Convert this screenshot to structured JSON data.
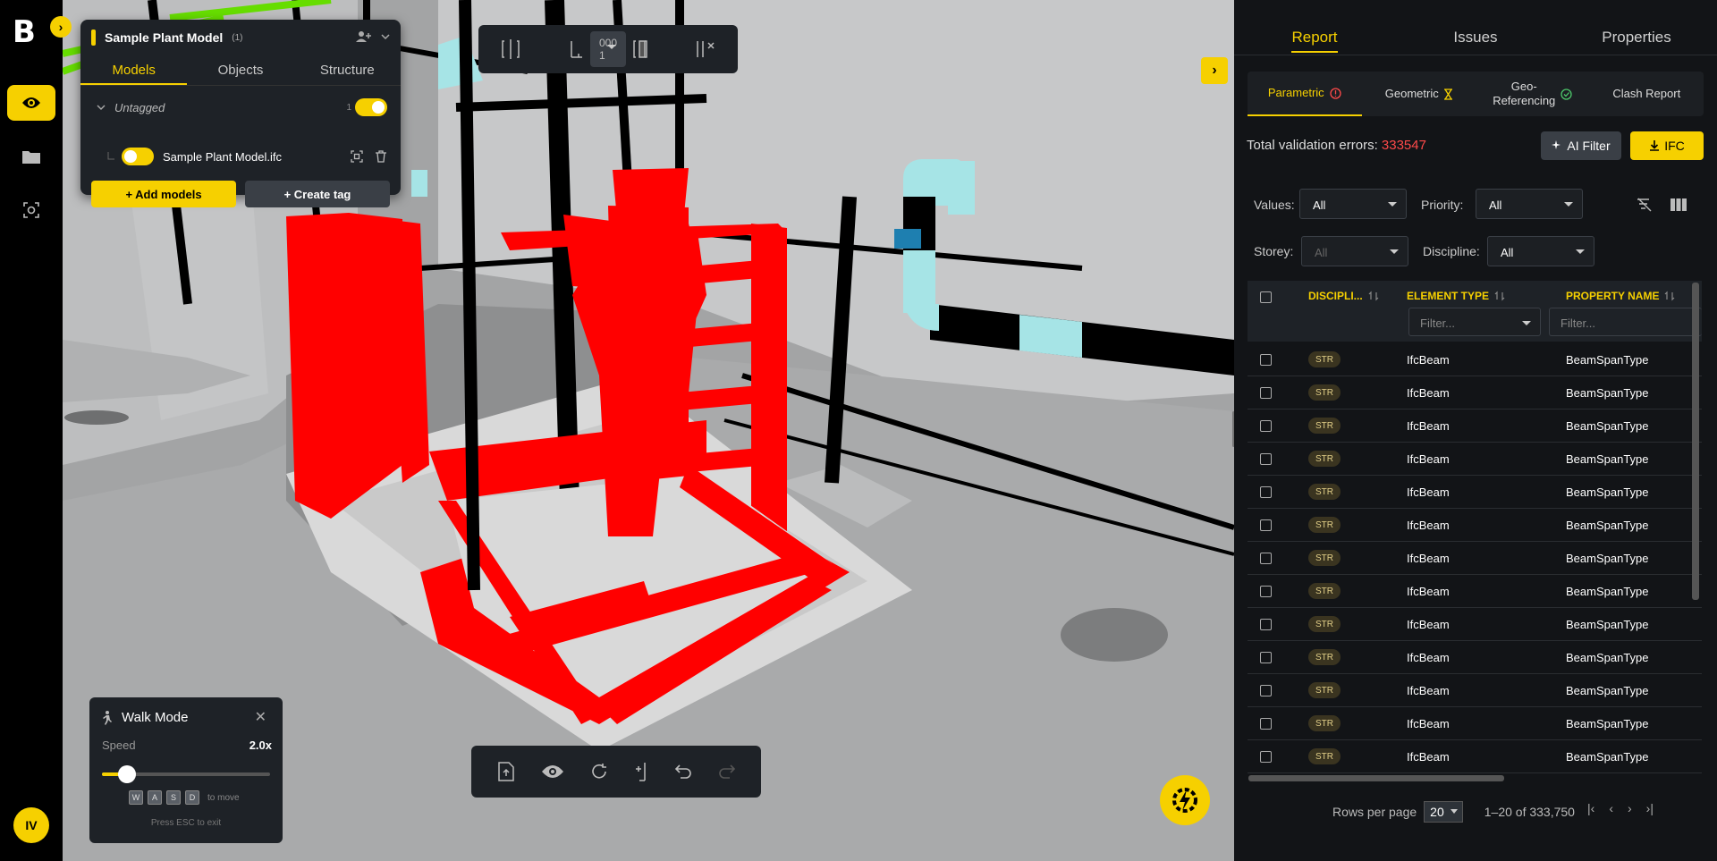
{
  "leftbar": {
    "logo": "B",
    "avatar": "IV",
    "nav": [
      {
        "icon": "eye-icon",
        "active": true
      },
      {
        "icon": "folder-icon",
        "active": false
      },
      {
        "icon": "scan-icon",
        "active": false
      }
    ]
  },
  "model_panel": {
    "title": "Sample Plant Model",
    "count": "(1)",
    "tabs": [
      "Models",
      "Objects",
      "Structure"
    ],
    "group_label": "Untagged",
    "group_count": "1",
    "file_name": "Sample Plant Model.ifc",
    "add_models": "+ Add models",
    "create_tag": "+ Create tag"
  },
  "top_toolbar": {
    "selected_label": "000 1"
  },
  "walk_mode": {
    "title": "Walk Mode",
    "speed_label": "Speed",
    "speed_value": "2.0x",
    "speed_fraction": 0.15,
    "keys": [
      "W",
      "A",
      "S",
      "D"
    ],
    "keys_hint": "to move",
    "esc_hint": "Press ESC to exit"
  },
  "report": {
    "tabs": [
      "Report",
      "Issues",
      "Properties"
    ],
    "subtabs": [
      "Parametric",
      "Geometric",
      "Geo-\nReferencing",
      "Clash Report"
    ],
    "total_label": "Total validation errors:",
    "total_value": "333547",
    "ai_filter": "AI Filter",
    "ifc": "IFC",
    "filters": {
      "values_label": "Values:",
      "values": "All",
      "priority_label": "Priority:",
      "priority": "All",
      "storey_label": "Storey:",
      "storey": "All",
      "discipline_label": "Discipline:",
      "discipline": "All"
    },
    "columns": [
      "DISCIPLI...",
      "ELEMENT TYPE",
      "PROPERTY NAME"
    ],
    "filter_placeholder": "Filter...",
    "rows": [
      {
        "discipline": "STR",
        "element_type": "IfcBeam",
        "property": "BeamSpanType"
      },
      {
        "discipline": "STR",
        "element_type": "IfcBeam",
        "property": "BeamSpanType"
      },
      {
        "discipline": "STR",
        "element_type": "IfcBeam",
        "property": "BeamSpanType"
      },
      {
        "discipline": "STR",
        "element_type": "IfcBeam",
        "property": "BeamSpanType"
      },
      {
        "discipline": "STR",
        "element_type": "IfcBeam",
        "property": "BeamSpanType"
      },
      {
        "discipline": "STR",
        "element_type": "IfcBeam",
        "property": "BeamSpanType"
      },
      {
        "discipline": "STR",
        "element_type": "IfcBeam",
        "property": "BeamSpanType"
      },
      {
        "discipline": "STR",
        "element_type": "IfcBeam",
        "property": "BeamSpanType"
      },
      {
        "discipline": "STR",
        "element_type": "IfcBeam",
        "property": "BeamSpanType"
      },
      {
        "discipline": "STR",
        "element_type": "IfcBeam",
        "property": "BeamSpanType"
      },
      {
        "discipline": "STR",
        "element_type": "IfcBeam",
        "property": "BeamSpanType"
      },
      {
        "discipline": "STR",
        "element_type": "IfcBeam",
        "property": "BeamSpanType"
      },
      {
        "discipline": "STR",
        "element_type": "IfcBeam",
        "property": "BeamSpanType"
      }
    ],
    "rows_per_page_label": "Rows per page",
    "rows_per_page": "20",
    "range": "1–20 of 333,750"
  },
  "colors": {
    "accent": "#f6d000",
    "error": "#ff4a4a",
    "highlight": "#ff0000",
    "pipe": "#a6e4e6"
  }
}
